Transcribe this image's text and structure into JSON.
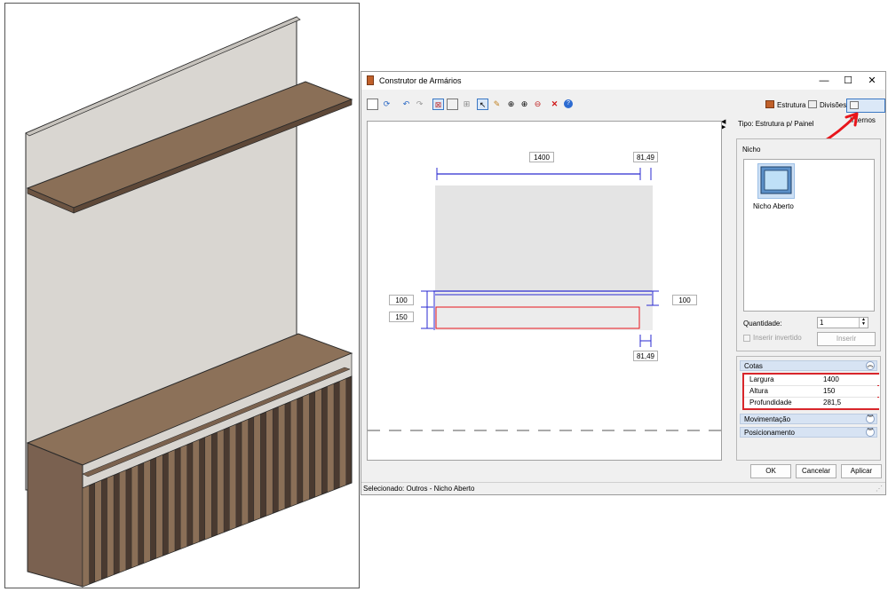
{
  "window": {
    "title": "Construtor de Armários",
    "minimize": "—",
    "maximize": "☐",
    "close": "✕"
  },
  "toolbar": {
    "tabs": [
      {
        "label": "Estrutura",
        "icon": "structure-icon"
      },
      {
        "label": "Divisões",
        "icon": "grid-icon"
      },
      {
        "label": "Internos",
        "icon": "internals-icon",
        "active": true
      }
    ]
  },
  "type_label": "Tipo: Estrutura p/ Painel",
  "drawing": {
    "dim_top_width": "1400",
    "dim_top_right": "81,49",
    "dim_left_upper": "100",
    "dim_left_lower": "150",
    "dim_right": "100",
    "dim_bottom_right": "81,49"
  },
  "nicho": {
    "group_label": "Nicho",
    "item_label": "Nicho Aberto",
    "quantity_label": "Quantidade:",
    "quantity_value": "1",
    "insert_inverted_label": "Inserir invertido",
    "insert_button": "Inserir"
  },
  "cotas": {
    "header": "Cotas",
    "rows": [
      {
        "name": "Largura",
        "value": "1400"
      },
      {
        "name": "Altura",
        "value": "150"
      },
      {
        "name": "Profundidade",
        "value": "281,5"
      }
    ]
  },
  "sections": {
    "movimentacao": "Movimentação",
    "posicionamento": "Posicionamento"
  },
  "buttons": {
    "ok": "OK",
    "cancel": "Cancelar",
    "apply": "Aplicar"
  },
  "status_bar": "Selecionado: Outros - Nicho Aberto",
  "colors": {
    "annotation_red": "#e8151b",
    "dimension_blue": "#2a2ad0",
    "wood": "#8a6f57",
    "panel": "#d9d6d1"
  }
}
